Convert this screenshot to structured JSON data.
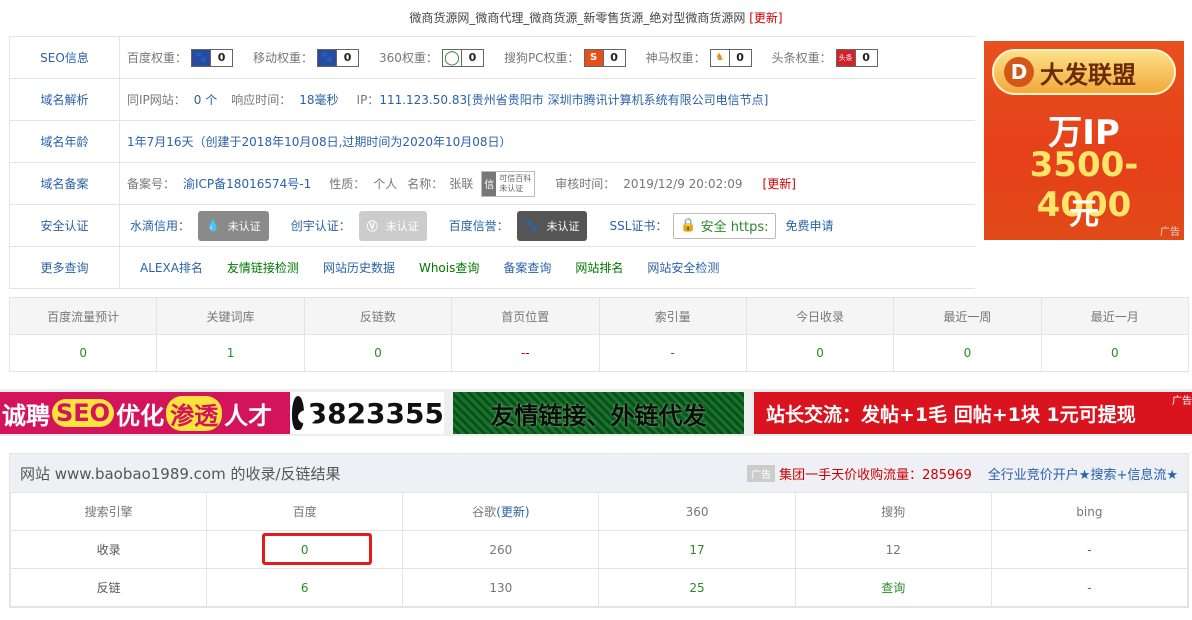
{
  "top": {
    "title": "微商货源网_微商代理_微商货源_新零售货源_绝对型微商货源网",
    "update": "[更新]"
  },
  "info": {
    "seo": {
      "label": "SEO信息",
      "weights": [
        {
          "name": "百度权重：",
          "icon": "paw-icon",
          "value": "0"
        },
        {
          "name": "移动权重：",
          "icon": "paw-icon",
          "value": "0"
        },
        {
          "name": "360权重：",
          "icon": "ring-icon",
          "value": "0"
        },
        {
          "name": "搜狗PC权重：",
          "icon": "sogou-icon",
          "value": "0"
        },
        {
          "name": "神马权重：",
          "icon": "shenma-icon",
          "value": "0"
        },
        {
          "name": "头条权重：",
          "icon": "toutiao-icon",
          "value": "0"
        }
      ]
    },
    "dns": {
      "label": "域名解析",
      "same_ip_label": "同IP网站：",
      "same_ip_value": "0 个",
      "resp_label": "响应时间：",
      "resp_value": "18毫秒",
      "ip_label": "IP：",
      "ip_value": "111.123.50.83[贵州省贵阳市 深圳市腾讯计算机系统有限公司电信节点]"
    },
    "age": {
      "label": "域名年龄",
      "value": "1年7月16天（创建于2018年10月08日,过期时间为2020年10月08日）"
    },
    "icp": {
      "label": "域名备案",
      "no_label": "备案号：",
      "no_value": "渝ICP备18016574号-1",
      "nature_label": "性质：",
      "nature_value": "个人",
      "name_label": "名称：",
      "name_value": "张联",
      "kxbk_char": "信",
      "kxbk_line1": "可信百科",
      "kxbk_line2": "未认证",
      "audit_label": "审核时间：",
      "audit_value": "2019/12/9 20:02:09",
      "update": "[更新]"
    },
    "cert": {
      "label": "安全认证",
      "shuidi_label": "水滴信用：",
      "shuidi_badge": "未认证",
      "chuangyu_label": "创宇认证：",
      "chuangyu_badge": "未认证",
      "baidu_label": "百度信誉：",
      "baidu_badge": "未认证",
      "ssl_label": "SSL证书：",
      "ssl_badge": "安全 https:",
      "apply": "免费申请"
    },
    "more": {
      "label": "更多查询",
      "links": [
        "ALEXA排名",
        "友情链接检测",
        "网站历史数据",
        "Whois查询",
        "备案查询",
        "网站排名",
        "网站安全检测"
      ]
    }
  },
  "ad_side": {
    "brand": "大发联盟",
    "line1": "万IP",
    "line2": "3500-4000",
    "line3": "元",
    "tag": "广告"
  },
  "stats": {
    "headers": [
      "百度流量预计",
      "关键词库",
      "反链数",
      "首页位置",
      "索引量",
      "今日收录",
      "最近一周",
      "最近一月"
    ],
    "values": [
      "0",
      "1",
      "0",
      "--",
      "-",
      "0",
      "0",
      "0"
    ]
  },
  "banners": {
    "b1": {
      "pre": "诚聘",
      "seo": "SEO",
      "mid": "优化",
      "st": "渗透",
      "post": "人才"
    },
    "b2": {
      "num": "3823355"
    },
    "b3": {
      "text": "友情链接、外链代发"
    },
    "b4": {
      "text": "站长交流：发帖+1毛  回帖+1块  1元可提现",
      "tag": "广告"
    }
  },
  "results": {
    "title": "网站 www.baobao1989.com 的收录/反链结果",
    "ad_tag": "广告",
    "ad_link1": "集团一手天价收购流量：285969",
    "ad_link2": "全行业竞价开户★搜索+信息流★",
    "headers": [
      "搜索引擎",
      "百度",
      "谷歌",
      "360",
      "搜狗",
      "bing"
    ],
    "google_update": "(更新)",
    "rows": [
      {
        "label": "收录",
        "baidu": "0",
        "google": "260",
        "s360": "17",
        "sogou": "12",
        "bing": "-"
      },
      {
        "label": "反链",
        "baidu": "6",
        "google": "130",
        "s360": "25",
        "sogou": "查询",
        "bing": "-"
      }
    ]
  }
}
